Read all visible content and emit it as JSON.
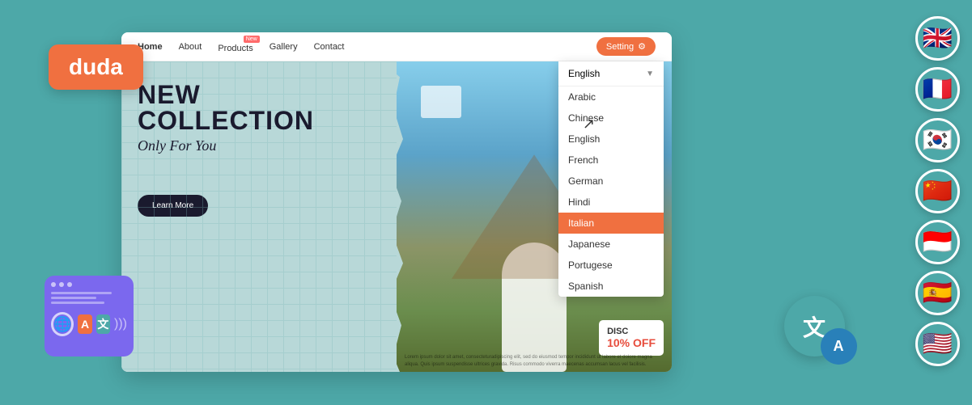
{
  "logo": {
    "text": "duda"
  },
  "nav": {
    "home": "Home",
    "about": "About",
    "products": "Products",
    "products_badge": "New",
    "gallery": "Gallery",
    "contact": "Contact",
    "setting_btn": "Setting"
  },
  "hero": {
    "title_line1": "NEW",
    "title_line2": "COLLECTION",
    "subtitle": "Only For You",
    "learn_more": "Learn More",
    "discount_label": "DISC",
    "discount_value": "10% OFF"
  },
  "language_dropdown": {
    "selected": "English",
    "options": [
      "Arabic",
      "Chinese",
      "English",
      "French",
      "German",
      "Hindi",
      "Italian",
      "Japanese",
      "Portugese",
      "Spanish"
    ],
    "highlighted": "Italian"
  },
  "flags": [
    {
      "name": "uk-flag",
      "emoji": "🇬🇧"
    },
    {
      "name": "france-flag",
      "emoji": "🇫🇷"
    },
    {
      "name": "korea-flag",
      "emoji": "🇰🇷"
    },
    {
      "name": "china-flag",
      "emoji": "🇨🇳"
    },
    {
      "name": "indonesia-flag",
      "emoji": "🇮🇩"
    },
    {
      "name": "spain-flag",
      "emoji": "🇪🇸"
    },
    {
      "name": "usa-flag",
      "emoji": "🇺🇸"
    }
  ],
  "lorem_text": "Lorem ipsum dolor sit amet, consecteturadipiscing elit, sed do eiusmod tempor incididunt ut labore et dolore magna aliqua. Quis ipsum suspendisse ultrices gravida. Risus commodo viverra maecenas accumsan lacus vel facilisis.",
  "widget": {
    "translate_zh": "文",
    "translate_a": "A"
  },
  "translate_icon": {
    "zh": "文",
    "a": "A"
  }
}
